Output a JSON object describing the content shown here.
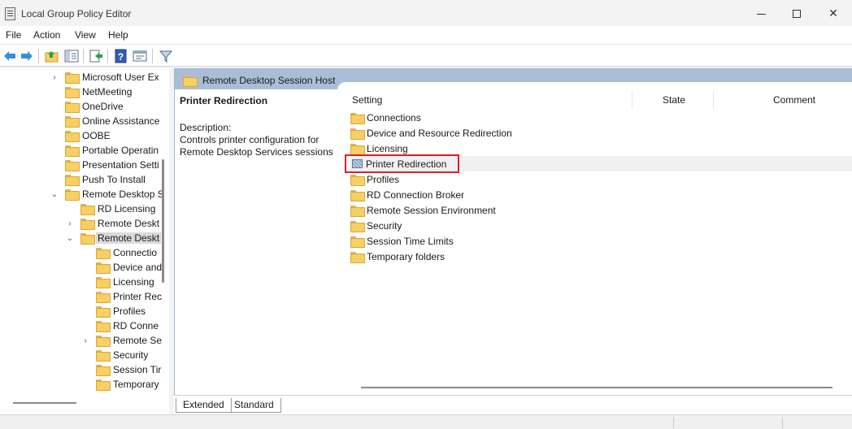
{
  "window": {
    "title": "Local Group Policy Editor"
  },
  "menu": [
    "File",
    "Action",
    "View",
    "Help"
  ],
  "toolbar": [
    "back-icon",
    "forward-icon",
    "up-folder-icon",
    "show-hide-tree-icon",
    "export-list-icon",
    "help-icon",
    "properties-icon",
    "filter-icon"
  ],
  "tree": {
    "items": [
      {
        "label": "Microsoft User Ex",
        "expander": "›"
      },
      {
        "label": "NetMeeting",
        "expander": ""
      },
      {
        "label": "OneDrive",
        "expander": ""
      },
      {
        "label": "Online Assistance",
        "expander": ""
      },
      {
        "label": "OOBE",
        "expander": ""
      },
      {
        "label": "Portable Operatin",
        "expander": ""
      },
      {
        "label": "Presentation Setti",
        "expander": ""
      },
      {
        "label": "Push To Install",
        "expander": ""
      },
      {
        "label": "Remote Desktop S",
        "expander": "⌄"
      },
      {
        "label": "RD Licensing",
        "expander": ""
      },
      {
        "label": "Remote Deskt",
        "expander": "›"
      },
      {
        "label": "Remote Deskt",
        "expander": "⌄"
      },
      {
        "label": "Connectio",
        "expander": ""
      },
      {
        "label": "Device and",
        "expander": ""
      },
      {
        "label": "Licensing",
        "expander": ""
      },
      {
        "label": "Printer Rec",
        "expander": ""
      },
      {
        "label": "Profiles",
        "expander": ""
      },
      {
        "label": "RD Conne",
        "expander": ""
      },
      {
        "label": "Remote Se",
        "expander": "›"
      },
      {
        "label": "Security",
        "expander": ""
      },
      {
        "label": "Session Tir",
        "expander": ""
      },
      {
        "label": "Temporary",
        "expander": ""
      }
    ]
  },
  "right": {
    "header": "Remote Desktop Session Host",
    "desc_title": "Printer Redirection",
    "desc_label": "Description:",
    "desc_text": "Controls printer configuration for Remote Desktop Services sessions",
    "columns": {
      "setting": "Setting",
      "state": "State",
      "comment": "Comment"
    },
    "rows": [
      {
        "label": "Connections",
        "icon": "folder-icon"
      },
      {
        "label": "Device and Resource Redirection",
        "icon": "folder-icon"
      },
      {
        "label": "Licensing",
        "icon": "folder-icon"
      },
      {
        "label": "Printer Redirection",
        "icon": "policy-setting-icon"
      },
      {
        "label": "Profiles",
        "icon": "folder-icon"
      },
      {
        "label": "RD Connection Broker",
        "icon": "folder-icon"
      },
      {
        "label": "Remote Session Environment",
        "icon": "folder-icon"
      },
      {
        "label": "Security",
        "icon": "folder-icon"
      },
      {
        "label": "Session Time Limits",
        "icon": "folder-icon"
      },
      {
        "label": "Temporary folders",
        "icon": "folder-icon"
      }
    ]
  },
  "tabs": [
    "Extended",
    "Standard"
  ],
  "colors": {
    "header_band": "#a9bed6",
    "highlight_border": "#e01f26",
    "folder": "#f7cf62"
  }
}
